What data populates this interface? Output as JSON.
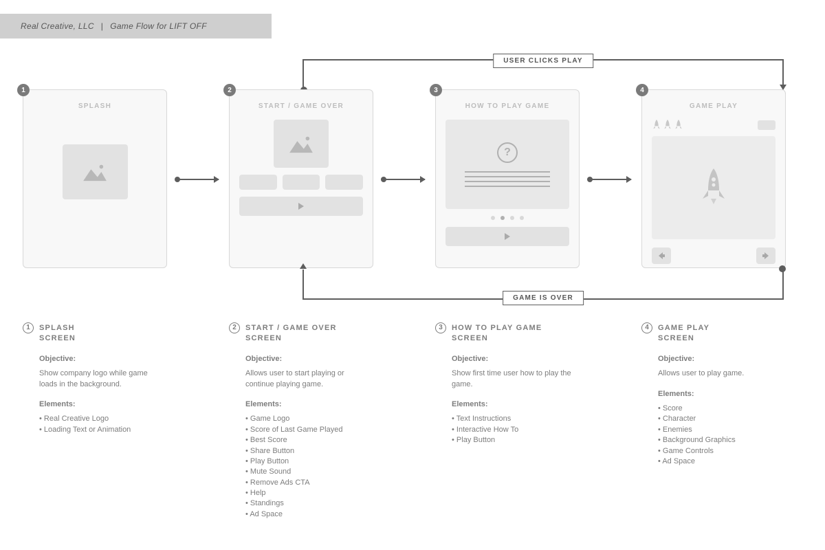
{
  "header": {
    "company": "Real Creative, LLC",
    "separator": "|",
    "project": "Game Flow for LIFT OFF"
  },
  "connectors": {
    "top": "USER CLICKS PLAY",
    "bottom": "GAME IS OVER"
  },
  "cards": [
    {
      "num": "1",
      "label": "SPLASH"
    },
    {
      "num": "2",
      "label": "START / GAME OVER"
    },
    {
      "num": "3",
      "label": "HOW TO PLAY GAME"
    },
    {
      "num": "4",
      "label": "GAME PLAY"
    }
  ],
  "descriptions": [
    {
      "num": "1",
      "title": "SPLASH\nSCREEN",
      "objective_h": "Objective:",
      "objective": "Show company logo while game loads in the background.",
      "elements_h": "Elements:",
      "elements": [
        "Real Creative Logo",
        "Loading Text or Animation"
      ]
    },
    {
      "num": "2",
      "title": "START /  GAME OVER\nSCREEN",
      "objective_h": "Objective:",
      "objective": "Allows user to start playing or continue playing game.",
      "elements_h": "Elements:",
      "elements": [
        "Game Logo",
        "Score of Last Game Played",
        "Best Score",
        "Share Button",
        "Play Button",
        "Mute Sound",
        "Remove Ads CTA",
        "Help",
        "Standings",
        "Ad Space"
      ]
    },
    {
      "num": "3",
      "title": "HOW TO PLAY GAME\nSCREEN",
      "objective_h": "Objective:",
      "objective": "Show first time user how to play the game.",
      "elements_h": "Elements:",
      "elements": [
        "Text Instructions",
        "Interactive How To",
        "Play Button"
      ]
    },
    {
      "num": "4",
      "title": "GAME PLAY\nSCREEN",
      "objective_h": "Objective:",
      "objective": "Allows user to play game.",
      "elements_h": "Elements:",
      "elements": [
        "Score",
        "Character",
        "Enemies",
        "Background Graphics",
        "Game Controls",
        "Ad Space"
      ]
    }
  ]
}
